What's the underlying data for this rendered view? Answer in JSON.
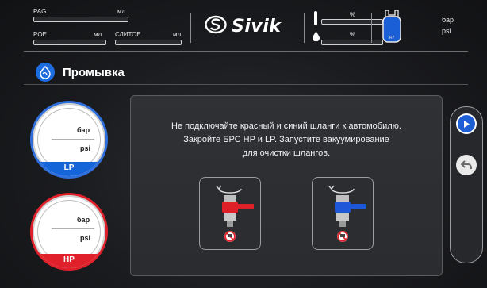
{
  "topbar": {
    "pag_label": "PAG",
    "pag_unit": "мл",
    "poe_label": "POE",
    "poe_unit": "мл",
    "drain_label": "СЛИТОЕ",
    "drain_unit": "мл",
    "brand_name": "Sivik",
    "percent_top": "%",
    "percent_bottom": "%",
    "tank_label": "R7",
    "unit_bar": "бар",
    "unit_psi": "psi"
  },
  "page": {
    "title": "Промывка"
  },
  "gauges": {
    "lp": {
      "unit_bar": "бар",
      "unit_psi": "psi",
      "label": "LP",
      "color": "#1565d8"
    },
    "hp": {
      "unit_bar": "бар",
      "unit_psi": "psi",
      "label": "HP",
      "color": "#e0202a"
    }
  },
  "message": {
    "line1": "Не подключайте красный и синий шланги к автомобилю.",
    "line2": "Закройте БРС HP и LP. Запустите вакуумирование",
    "line3": "для очистки шлангов."
  },
  "side": {
    "play_icon": "play-icon",
    "back_icon": "back-arrow-icon"
  },
  "colors": {
    "accent_blue": "#1e6de0",
    "hp_red": "#e0202a",
    "lp_blue": "#1565d8",
    "background": "#1a1b1e"
  }
}
